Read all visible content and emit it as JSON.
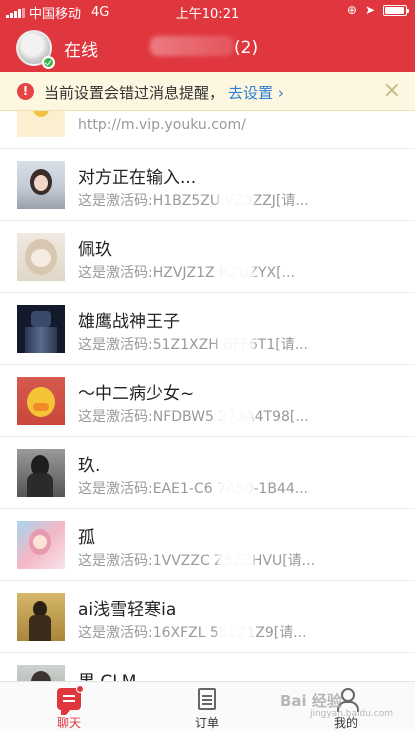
{
  "status_bar": {
    "carrier": "中国移动",
    "network": "4G",
    "time": "上午10:21"
  },
  "header": {
    "status": "在线",
    "title_suffix": "(2)"
  },
  "notice": {
    "message": "当前设置会错过消息提醒，",
    "link": "去设置",
    "link_arrow": "›",
    "close": "×"
  },
  "conversations": {
    "top_preview": "http://m.vip.youku.com/",
    "items": [
      {
        "name": "对方正在输入...",
        "preview": "这是激活码:H1BZ5ZU      VZ3ZZJ[请..."
      },
      {
        "name": "佩玖",
        "preview": "这是激活码:HZVJZ1Z      RZUZYX[..."
      },
      {
        "name": "雄鹰战神王子",
        "preview": "这是激活码:51Z1XZH      BFF6T1[请..."
      },
      {
        "name": "～中二病少女~",
        "preview": "这是激活码:NFDBW5      273A4T98[..."
      },
      {
        "name": "玖.",
        "preview": "这是激活码:EAE1-C6      7A50-1B44..."
      },
      {
        "name": "孤",
        "preview": "这是激活码:1VVZZC      Z5ZZHVU[请..."
      },
      {
        "name": "ai浅雪轻寒ia",
        "preview": "这是激活码:16XFZL      552Z1Z9[请..."
      },
      {
        "name": "果 CLM",
        "preview": ""
      }
    ]
  },
  "tabbar": {
    "chat": "聊天",
    "orders": "订单",
    "me": "我的"
  },
  "watermark": {
    "text": "Bai 经验",
    "sub": "jingyan.baidu.com"
  }
}
